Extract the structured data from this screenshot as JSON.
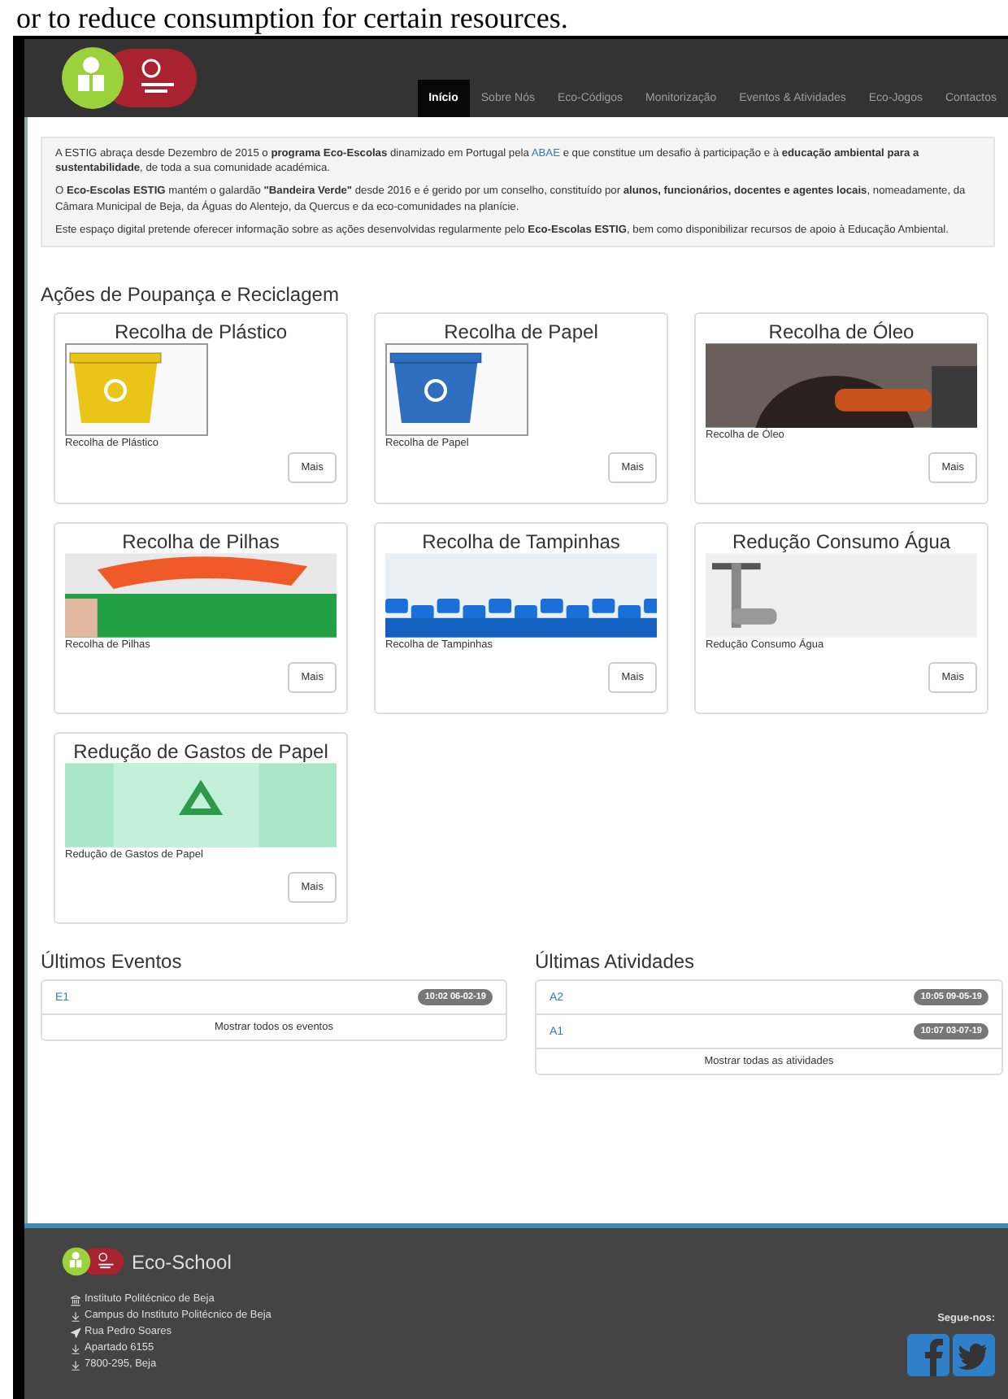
{
  "caption": "or to reduce consumption for certain resources.",
  "header": {
    "nav": [
      {
        "label": "Início",
        "selected": true
      },
      {
        "label": "Sobre Nós",
        "selected": false
      },
      {
        "label": "Eco-Códigos",
        "selected": false
      },
      {
        "label": "Monitorização",
        "selected": false
      },
      {
        "label": "Eventos & Atividades",
        "selected": false
      },
      {
        "label": "Eco-Jogos",
        "selected": false
      },
      {
        "label": "Contactos",
        "selected": false
      }
    ]
  },
  "intro": {
    "paragraphs": [
      {
        "before": "A ESTIG abraça desde Dezembro de 2015 o **programa Eco-Escolas** dinamizado em Portugal pela",
        "link": "ABAE",
        "after": "e que constitue um desafio à participação e à **educação ambiental para a sustentabilidade**, de toda a sua comunidade académica."
      },
      {
        "before": "O **Eco-Escolas ESTIG** mantém o galardão **\"Bandeira Verde\"** desde 2016 e é gerido por um conselho, constituído por **alunos, funcionários, docentes e agentes locais**, nomeadamente, da Câmara Municipal de Beja, da Águas do Alentejo, da Quercus e da eco-comunidades na planície."
      },
      {
        "before": "Este espaço digital pretende oferecer informação sobre as ações desenvolvidas regularmente pelo **Eco-Escolas ESTIG**, bem como disponibilizar recursos de apoio à Educação Ambiental."
      }
    ]
  },
  "actions": {
    "title": "Ações de Poupança e Reciclagem",
    "cards": [
      {
        "title": "Recolha de Plástico",
        "kind": "plastic-bin",
        "caption": "Recolha de Plástico",
        "button": "Mais"
      },
      {
        "title": "Recolha de Papel",
        "kind": "paper-bin",
        "caption": "Recolha de Papel",
        "button": "Mais"
      },
      {
        "title": "Recolha de Óleo",
        "kind": "oil",
        "caption": "Recolha de Óleo",
        "button": "Mais"
      },
      {
        "title": "Recolha de Pilhas",
        "kind": "batteries",
        "caption": "Recolha de Pilhas",
        "button": "Mais"
      },
      {
        "title": "Recolha de Tampinhas",
        "kind": "caps",
        "caption": "Recolha de Tampinhas",
        "button": "Mais"
      },
      {
        "title": "Redução Consumo Água",
        "kind": "tap",
        "caption": "Redução Consumo Água",
        "button": "Mais"
      },
      {
        "title": "Redução de Gastos de Papel",
        "kind": "paper",
        "caption": "Redução de Gastos de Papel",
        "button": "Mais"
      }
    ]
  },
  "events": {
    "title": "Últimos Eventos",
    "items": [
      {
        "label": "E1",
        "time": "10:02 06-02-19"
      }
    ],
    "more": "Mostrar todos os eventos"
  },
  "activities": {
    "title": "Últimas Atividades",
    "items": [
      {
        "label": "A2",
        "time": "10:05 09-05-19"
      },
      {
        "label": "A1",
        "time": "10:07 03-07-19"
      }
    ],
    "more": "Mostrar todas as atividades"
  },
  "footer": {
    "brand": "Eco-School",
    "address": [
      {
        "kind": "building",
        "text": "Instituto Politécnico de Beja"
      },
      {
        "kind": "download",
        "text": "Campus do Instituto Politécnico de Beja"
      },
      {
        "kind": "arrow",
        "text": "Rua Pedro Soares"
      },
      {
        "kind": "download",
        "text": "Apartado 6155"
      },
      {
        "kind": "download",
        "text": "7800-295, Beja"
      }
    ],
    "follow": "Segue-nos:"
  }
}
